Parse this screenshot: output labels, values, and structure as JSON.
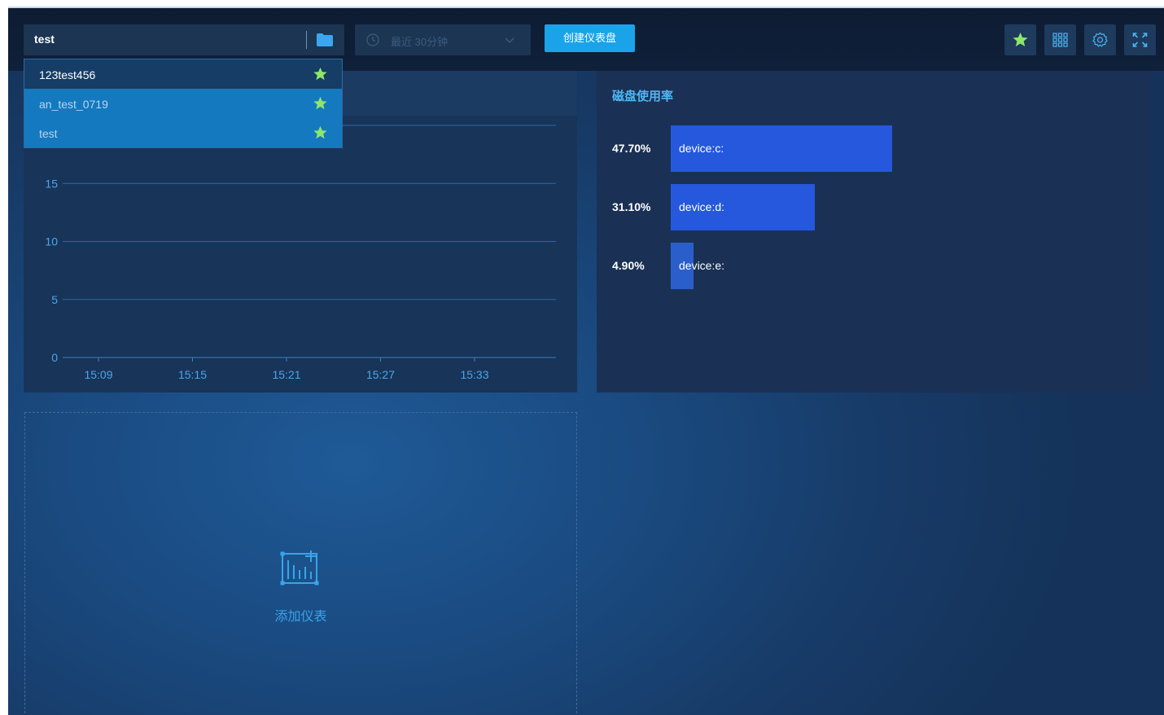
{
  "header": {
    "dashboard_selected": "test",
    "time_range_placeholder": "最近 30分钟",
    "create_button": "创建仪表盘"
  },
  "dropdown": {
    "items": [
      {
        "label": "123test456"
      },
      {
        "label": "an_test_0719"
      },
      {
        "label": "test"
      }
    ]
  },
  "left_chart": {
    "y_ticks": [
      "15",
      "10",
      "5",
      "0"
    ],
    "x_ticks": [
      "15:09",
      "15:15",
      "15:21",
      "15:27",
      "15:33"
    ]
  },
  "disk_panel": {
    "title": "磁盘使用率"
  },
  "add_panel": {
    "label": "添加仪表"
  },
  "colors": {
    "accent": "#1aa3e8",
    "bar": "#2558dc",
    "star": "#8ee66a",
    "axis_text": "#4aa6e8"
  },
  "chart_data": [
    {
      "type": "line",
      "title": "",
      "x": [
        "15:09",
        "15:15",
        "15:21",
        "15:27",
        "15:33"
      ],
      "ylim": [
        0,
        20
      ],
      "y_ticks": [
        0,
        5,
        10,
        15
      ],
      "series": [],
      "grid": true
    },
    {
      "type": "bar",
      "orientation": "horizontal",
      "title": "磁盘使用率",
      "categories": [
        "device:c:",
        "device:d:",
        "device:e:"
      ],
      "values": [
        47.7,
        31.1,
        4.9
      ],
      "value_labels": [
        "47.70%",
        "31.10%",
        "4.90%"
      ],
      "unit": "%",
      "xlim": [
        0,
        100
      ]
    }
  ]
}
